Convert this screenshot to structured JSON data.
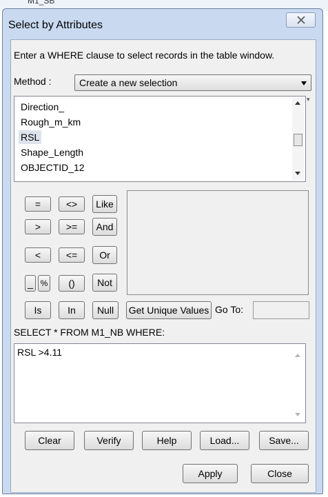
{
  "window": {
    "title": "Select by Attributes",
    "background_title": "M1_SB"
  },
  "instruction": "Enter a WHERE clause to select records in the table window.",
  "method": {
    "label": "Method :",
    "selected": "Create a new selection"
  },
  "fields": {
    "items": [
      "Direction_",
      "Rough_m_km",
      "RSL",
      "Shape_Length",
      "OBJECTID_12"
    ],
    "selected": "RSL"
  },
  "operators": {
    "eq": "=",
    "ne": "<>",
    "like": "Like",
    "gt": ">",
    "ge": ">=",
    "and": "And",
    "lt": "<",
    "le": "<=",
    "or": "Or",
    "underscore": "_",
    "percent": "%",
    "parens": "()",
    "not": "Not",
    "is": "Is",
    "in": "In",
    "null": "Null"
  },
  "unique_values_button": "Get Unique Values",
  "goto_label": "Go To:",
  "goto_value": "",
  "select_statement": "SELECT * FROM M1_NB WHERE:",
  "where_clause": "RSL >4.11",
  "buttons": {
    "clear": "Clear",
    "verify": "Verify",
    "help": "Help",
    "load": "Load...",
    "save": "Save...",
    "apply": "Apply",
    "close": "Close"
  },
  "colors": {
    "frame": "#c9daf0",
    "client": "#f0f0f0",
    "selection": "#dde3ec"
  }
}
